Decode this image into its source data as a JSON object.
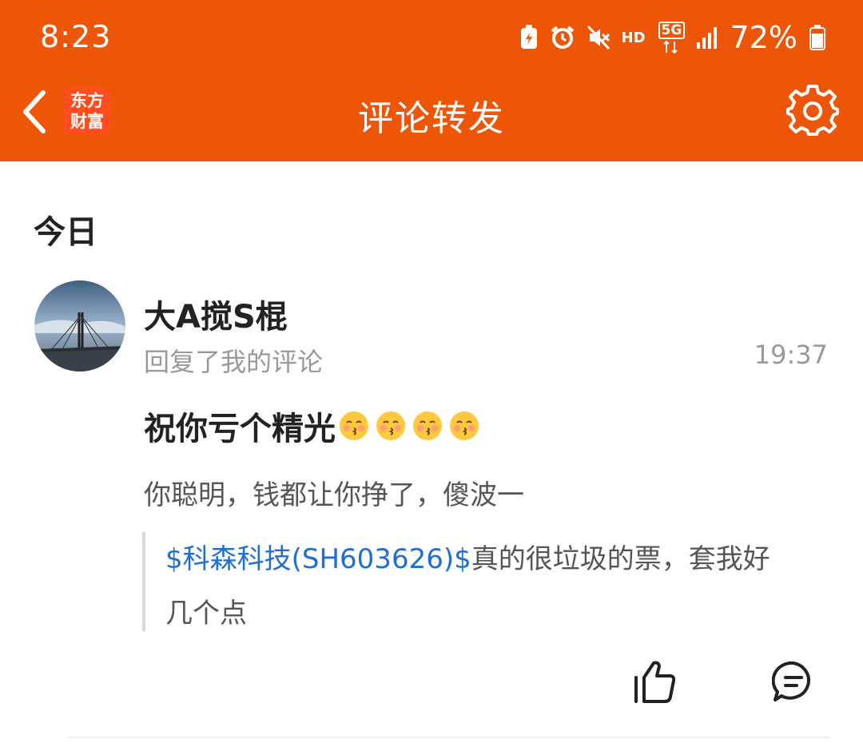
{
  "status_bar": {
    "time": "8:23",
    "network": "HD",
    "network_type": "5G",
    "battery": "72%",
    "icons": [
      "battery-saver-icon",
      "alarm-icon",
      "mute-icon",
      "hd-icon",
      "5g-icon",
      "signal-icon",
      "battery-icon"
    ]
  },
  "nav": {
    "back_icon": "chevron-left-icon",
    "logo_line1": "东方",
    "logo_line2": "财富",
    "title": "评论转发",
    "settings_icon": "gear-icon"
  },
  "section": {
    "title": "今日"
  },
  "notification": {
    "avatar_icon": "bridge-photo-avatar",
    "username": "大A搅S棍",
    "action": "回复了我的评论",
    "time": "19:37",
    "reply_text": "祝你亏个精光",
    "emoji_count": 4,
    "my_comment": "你聪明，钱都让你挣了，傻波一",
    "quote_stock": "$科森科技(SH603626)$",
    "quote_text_line1": "真的很垃圾的票，套我好",
    "quote_text_line2": "几个点",
    "like_icon": "thumbs-up-icon",
    "comment_icon": "comment-bubble-icon"
  },
  "colors": {
    "brand": "#ec5606",
    "link": "#1f6fd1",
    "muted": "#999999"
  }
}
